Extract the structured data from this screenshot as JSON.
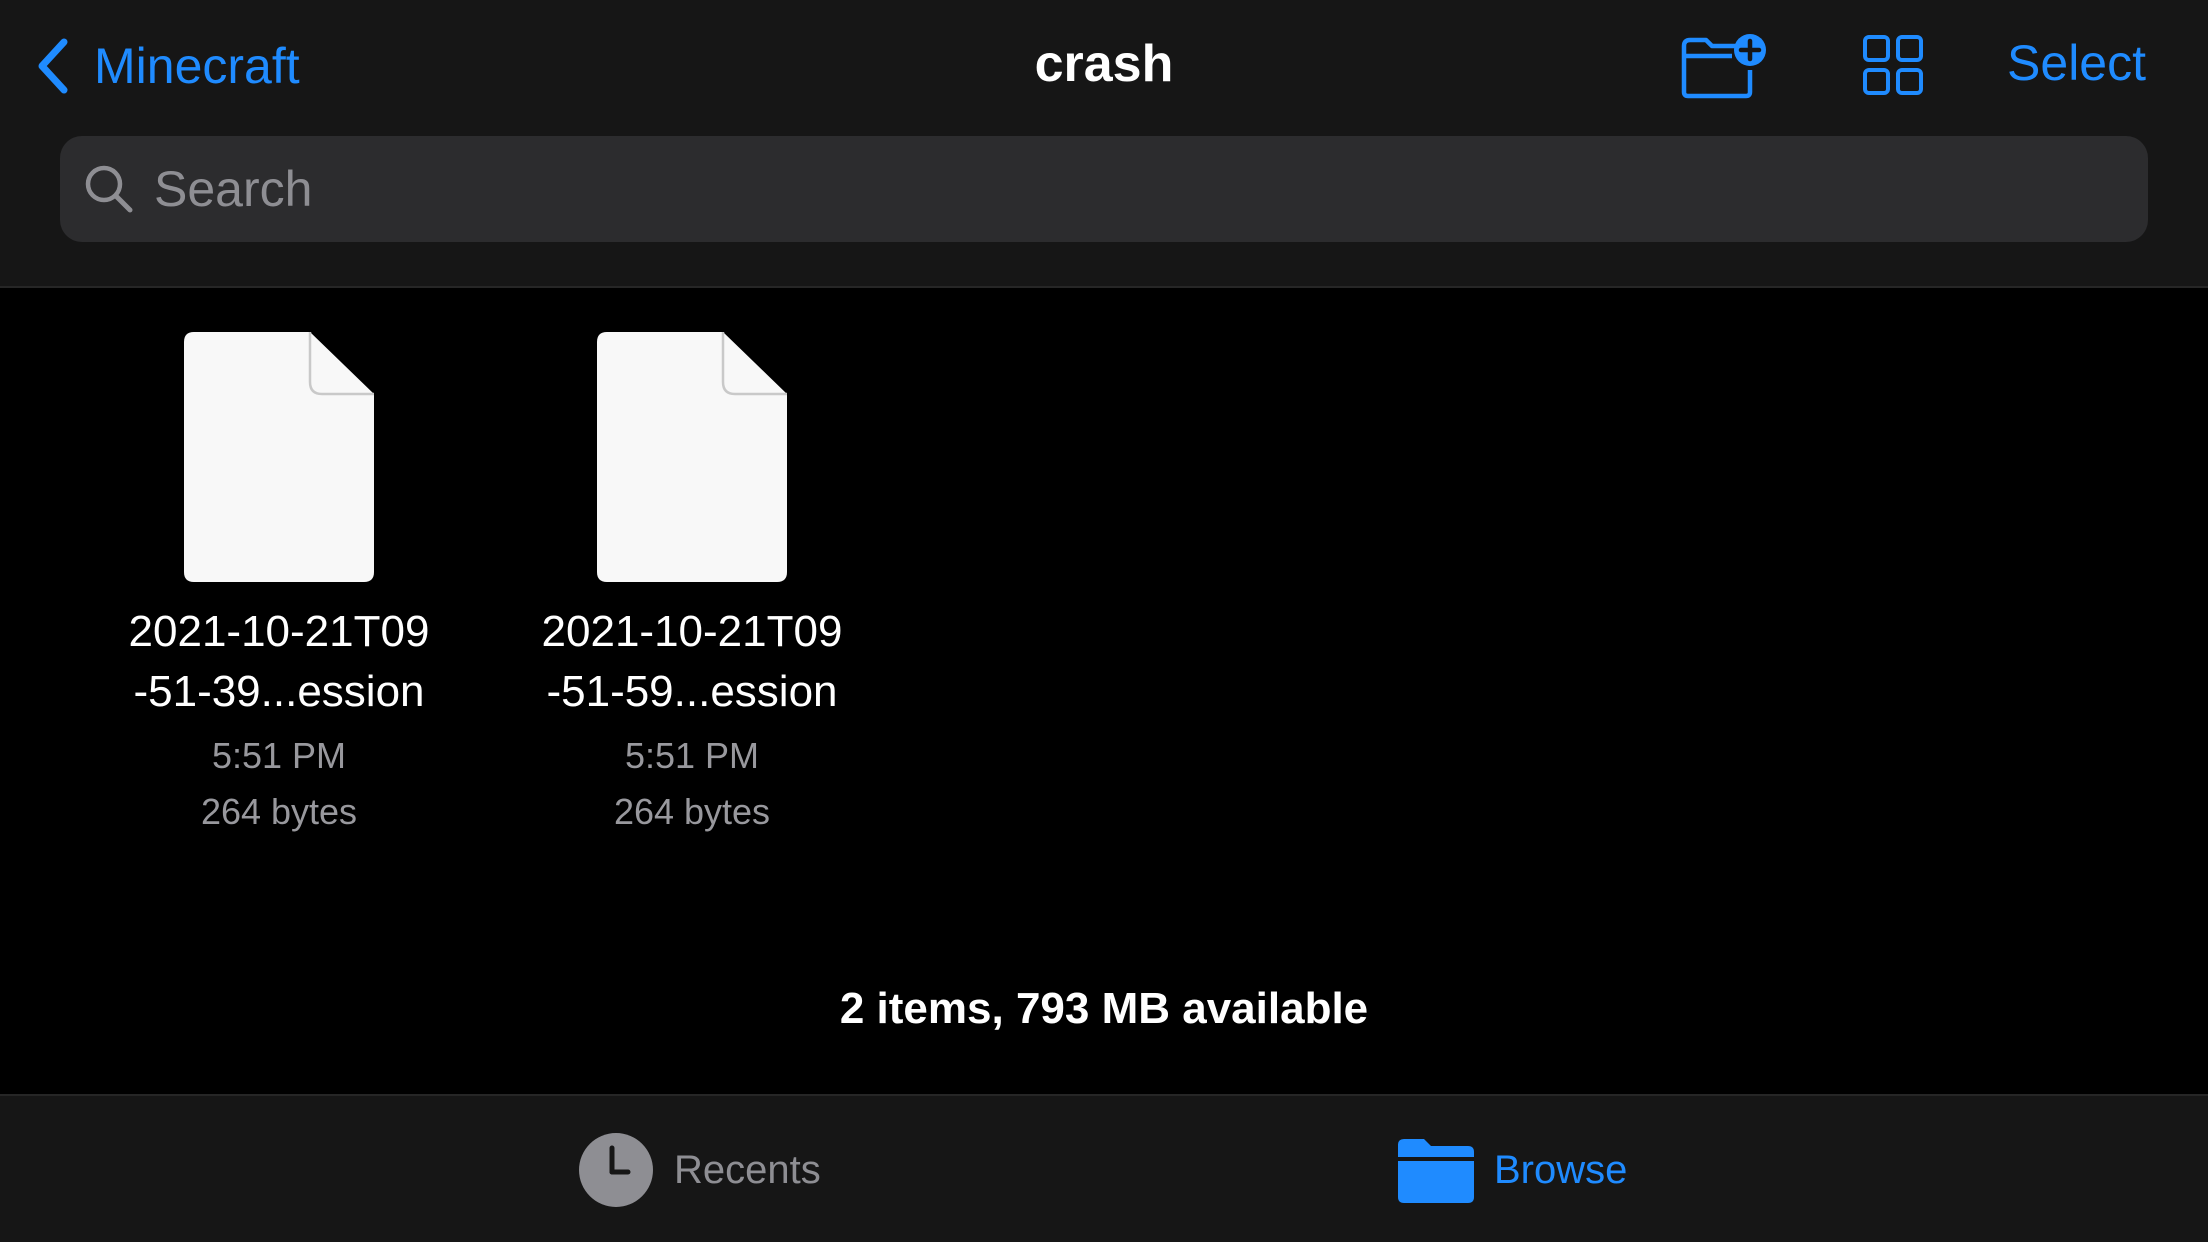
{
  "colors": {
    "accent": "#1f8bff",
    "background": "#000000",
    "bar_background": "#161616",
    "search_background": "#2c2c2e",
    "secondary_text": "#98989d",
    "file_icon": "#f8f8f8"
  },
  "navbar": {
    "back_label": "Minecraft",
    "back_icon": "chevron-left-icon",
    "title": "crash",
    "new_folder_icon": "folder-plus-icon",
    "view_icon": "grid-view-icon",
    "select_label": "Select"
  },
  "search": {
    "icon": "magnifying-glass-icon",
    "placeholder": "Search",
    "value": ""
  },
  "files": [
    {
      "name_line1": "2021-10-21T09",
      "name_line2": "-51-39...ession",
      "time": "5:51 PM",
      "size": "264 bytes",
      "icon": "document-icon"
    },
    {
      "name_line1": "2021-10-21T09",
      "name_line2": "-51-59...ession",
      "time": "5:51 PM",
      "size": "264 bytes",
      "icon": "document-icon"
    }
  ],
  "status": "2 items, 793 MB available",
  "tabbar": {
    "recents_label": "Recents",
    "recents_icon": "clock-icon",
    "browse_label": "Browse",
    "browse_icon": "folder-icon",
    "selected": "Browse"
  }
}
